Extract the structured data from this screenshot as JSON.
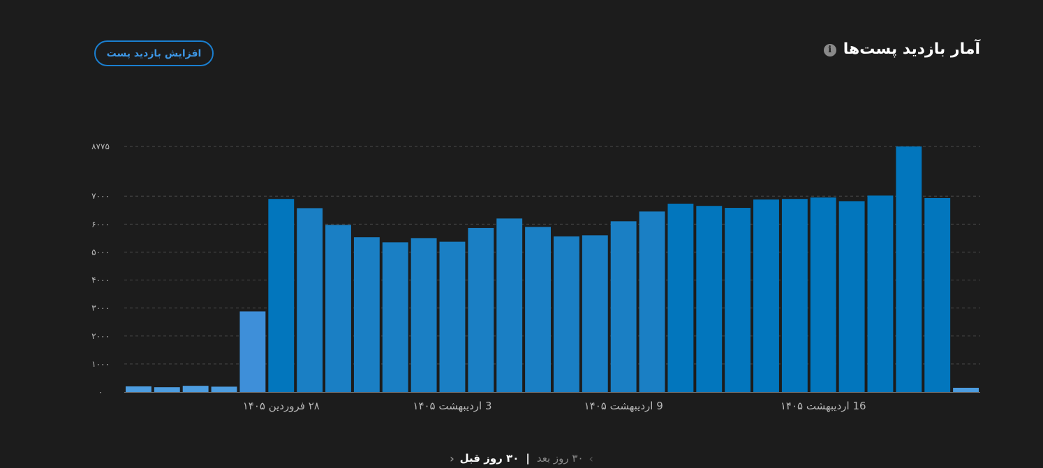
{
  "header": {
    "title": "آمار بازدید پست‌ها",
    "info_icon": "info-icon",
    "boost_button_label": "افزایش بازدید پست"
  },
  "nav": {
    "prev_label": "۳۰ روز قبل",
    "separator": "|",
    "next_label": "۳۰ روز بعد",
    "prev_icon": "chevron-left-icon",
    "next_icon": "chevron-right-icon"
  },
  "colors": {
    "bar_dark": "#0276bd",
    "bar_mid": "#1a7fc4",
    "bar_light": "#3e8fd9",
    "bar_pale": "#4d9de0",
    "grid": "#4a4a4a",
    "axis": "#7a7a7a",
    "tick_text": "#b8b8b8",
    "date_text": "#b8b8b8"
  },
  "chart_data": {
    "type": "bar",
    "title": "",
    "xlabel": "",
    "ylabel": "",
    "ylim": [
      0,
      8775
    ],
    "y_ticks": [
      0,
      1000,
      2000,
      3000,
      4000,
      5000,
      6000,
      7000,
      8775
    ],
    "y_tick_labels": [
      "۰",
      "۱۰۰۰",
      "۲۰۰۰",
      "۳۰۰۰",
      "۴۰۰۰",
      "۵۰۰۰",
      "۶۰۰۰",
      "۷۰۰۰",
      "۸۷۷۵"
    ],
    "grid": true,
    "values": [
      200,
      170,
      220,
      190,
      2880,
      6900,
      6570,
      5970,
      5530,
      5350,
      5500,
      5370,
      5860,
      6200,
      5900,
      5560,
      5600,
      6100,
      6450,
      6730,
      6650,
      6580,
      6880,
      6900,
      6950,
      6820,
      7020,
      8775,
      6930,
      150
    ],
    "shades": [
      "pale",
      "pale",
      "pale",
      "pale",
      "light",
      "dark",
      "mid",
      "mid",
      "mid",
      "mid",
      "mid",
      "mid",
      "mid",
      "mid",
      "mid",
      "mid",
      "mid",
      "mid",
      "mid",
      "dark",
      "dark",
      "dark",
      "dark",
      "dark",
      "dark",
      "dark",
      "dark",
      "dark",
      "dark",
      "pale"
    ],
    "x_labels": [
      {
        "index": 5,
        "text": "۲۸ فروردین ۱۴۰۵"
      },
      {
        "index": 11,
        "text": "3 اردیبهشت ۱۴۰۵"
      },
      {
        "index": 17,
        "text": "9 اردیبهشت ۱۴۰۵"
      },
      {
        "index": 24,
        "text": "16 اردیبهشت ۱۴۰۵"
      }
    ]
  }
}
